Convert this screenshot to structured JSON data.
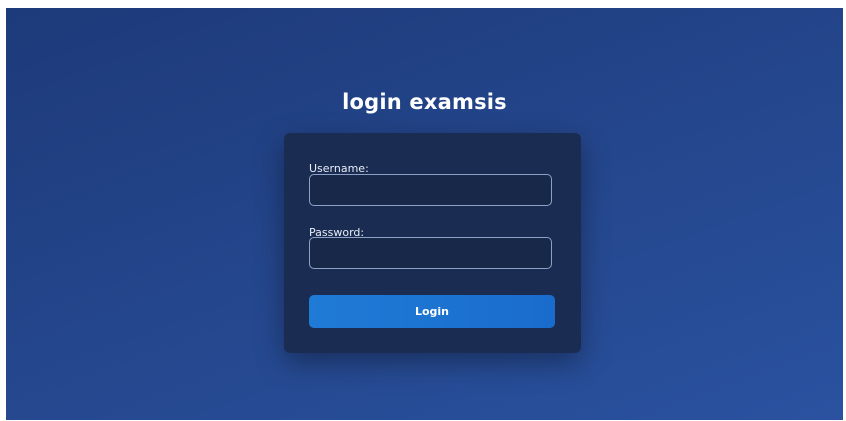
{
  "page": {
    "title": "login examsis"
  },
  "form": {
    "username_label": "Username:",
    "username_value": "",
    "password_label": "Password:",
    "password_value": "",
    "login_label": "Login"
  },
  "colors": {
    "background": "#24468c",
    "card": "#1a2c52",
    "button": "#1f7bd6",
    "input_border": "#8ea2c8"
  }
}
